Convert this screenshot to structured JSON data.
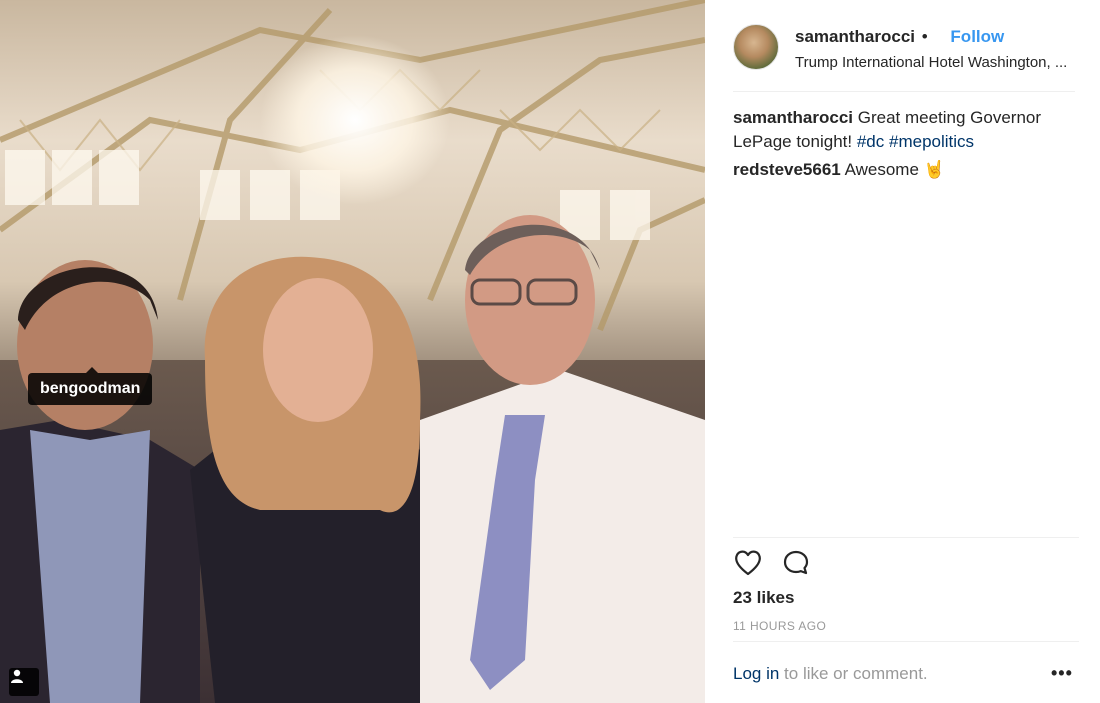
{
  "post": {
    "username": "samantharocci",
    "dot": "•",
    "follow_label": "Follow",
    "location": "Trump International Hotel Washington, ...",
    "caption_text": "Great meeting Governor LePage tonight!",
    "hashtags": [
      "#dc",
      "#mepolitics"
    ]
  },
  "comments": [
    {
      "user": "redsteve5661",
      "text": "Awesome 🤘"
    }
  ],
  "photo": {
    "tag_label": "bengoodman",
    "accent_background": "#2a2428"
  },
  "actions": {
    "like_icon": "heart-icon",
    "comment_icon": "comment-bubble-icon"
  },
  "likes_text": "23 likes",
  "timestamp_text": "11 HOURS AGO",
  "login": {
    "link_label": "Log in",
    "rest_text": " to like or comment."
  },
  "more_label": "•••",
  "colors": {
    "link_blue": "#3897f0",
    "hashtag_blue": "#003569",
    "muted": "#999999"
  }
}
